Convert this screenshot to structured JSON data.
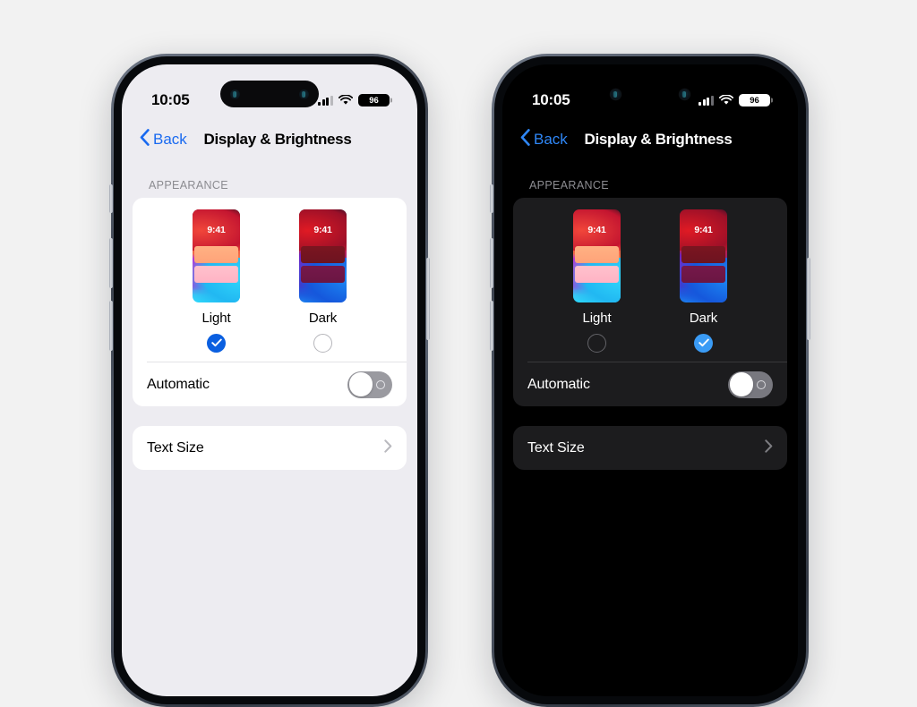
{
  "page": {
    "background_color": "#f2f2f2"
  },
  "phones": [
    {
      "id": "light",
      "theme": "Light",
      "frame_color": "#3d4450",
      "screen_background": "#edecf1",
      "accent_color": "#0a5fe0",
      "link_color": "#1a6af0",
      "status_bar": {
        "time": "10:05",
        "cellular_icon": "cellular-bars-icon",
        "wifi_icon": "wifi-icon",
        "battery_icon": "battery-icon",
        "battery_percent": "96"
      },
      "nav": {
        "back_icon": "chevron-left-icon",
        "back_label": "Back",
        "title": "Display & Brightness"
      },
      "appearance": {
        "section_header": "APPEARANCE",
        "options": [
          {
            "label": "Light",
            "wallpaper_time": "9:41",
            "selected": true,
            "radio_icon": "radio-checked-icon"
          },
          {
            "label": "Dark",
            "wallpaper_time": "9:41",
            "selected": false,
            "radio_icon": "radio-unchecked-icon"
          }
        ],
        "automatic": {
          "label": "Automatic",
          "toggle_state": "off",
          "toggle_icon": "toggle-switch-icon"
        }
      },
      "text_size": {
        "label": "Text Size",
        "chevron_icon": "chevron-right-icon"
      }
    },
    {
      "id": "dark",
      "theme": "Dark",
      "frame_color": "#3d4450",
      "screen_background": "#000000",
      "accent_color": "#3a9bf5",
      "link_color": "#2f87f7",
      "status_bar": {
        "time": "10:05",
        "cellular_icon": "cellular-bars-icon",
        "wifi_icon": "wifi-icon",
        "battery_icon": "battery-icon",
        "battery_percent": "96"
      },
      "nav": {
        "back_icon": "chevron-left-icon",
        "back_label": "Back",
        "title": "Display & Brightness"
      },
      "appearance": {
        "section_header": "APPEARANCE",
        "options": [
          {
            "label": "Light",
            "wallpaper_time": "9:41",
            "selected": false,
            "radio_icon": "radio-unchecked-icon"
          },
          {
            "label": "Dark",
            "wallpaper_time": "9:41",
            "selected": true,
            "radio_icon": "radio-checked-icon"
          }
        ],
        "automatic": {
          "label": "Automatic",
          "toggle_state": "off",
          "toggle_icon": "toggle-switch-icon"
        }
      },
      "text_size": {
        "label": "Text Size",
        "chevron_icon": "chevron-right-icon"
      }
    }
  ]
}
